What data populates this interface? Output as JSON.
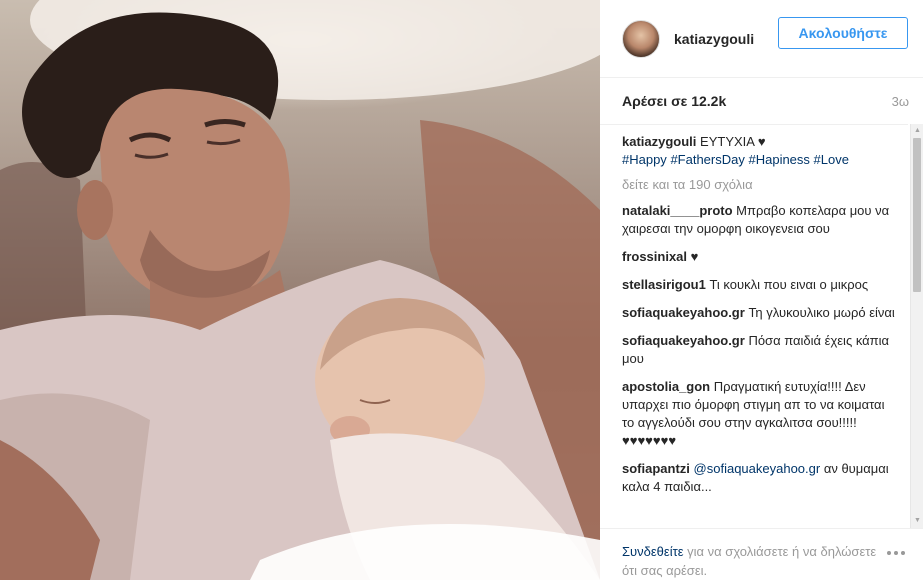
{
  "post": {
    "username": "katiazygouli",
    "follow_label": "Ακολουθήστε",
    "likes": "Αρέσει σε 12.2k",
    "time": "3ω",
    "caption_user": "katiazygouli",
    "caption_text": "ΕΥΤΥΧΙΑ ♥",
    "hashtags": [
      "#Happy",
      "#FathersDay",
      "#Hapiness",
      "#Love"
    ],
    "view_all_comments": "δείτε και τα 190 σχόλια"
  },
  "comments": [
    {
      "user": "natalaki____proto",
      "text": "Μπραβο κοπελαρα μου να χαιρεσαι την ομορφη οικογενεια σου"
    },
    {
      "user": "frossinixal",
      "text": "♥"
    },
    {
      "user": "stellasirigou1",
      "text": "Τι κουκλι που ειναι ο μικρος"
    },
    {
      "user": "sofiaquakeyahoo.gr",
      "text": "Τη γλυκουλικο μωρό είναι"
    },
    {
      "user": "sofiaquakeyahoo.gr",
      "text": "Πόσα παιδιά έχεις κάπια μου"
    },
    {
      "user": "apostolia_gon",
      "text": "Πραγματική ευτυχία!!!! Δεν υπαρχει πιο όμορφη στιγμη απ το να κοιμαται το αγγελούδι σου στην αγκαλιτσα σου!!!!!♥♥♥♥♥♥♥"
    },
    {
      "user": "sofiapantzi",
      "mention": "@sofiaquakeyahoo.gr",
      "text": "αν θυμαμαι καλα 4 παιδια..."
    }
  ],
  "footer": {
    "login_link": "Συνδεθείτε",
    "login_text": "για να σχολιάσετε ή να δηλώσετε ότι σας αρέσει."
  },
  "icons": {
    "more": "more-options-icon",
    "scroll_up": "scroll-up-arrow-icon",
    "scroll_down": "scroll-down-arrow-icon"
  },
  "colors": {
    "accent": "#3897f0",
    "link": "#003569",
    "muted": "#999999"
  }
}
